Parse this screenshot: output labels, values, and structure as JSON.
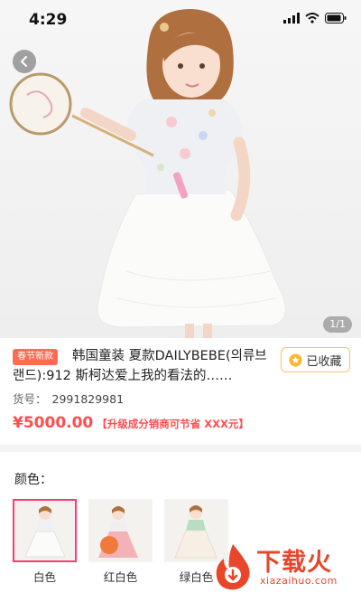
{
  "status_bar": {
    "time": "4:29"
  },
  "gallery": {
    "counter": "1/1"
  },
  "product": {
    "promo_tag": "春节新款",
    "title": "韩国童装 夏款DAILYBEBE(의류브랜드):912 斯柯达爱上我的看法的……",
    "favorite_label": "已收藏",
    "sku_label": "货号：",
    "sku_value": "2991829981",
    "price": "¥5000.00",
    "price_note": "【升级成分销商可节省 XXX元】"
  },
  "color_selector": {
    "heading": "颜色：",
    "options": [
      {
        "label": "白色",
        "selected": true,
        "dress_color": "#f5f3f0"
      },
      {
        "label": "红白色",
        "selected": false,
        "dress_color": "#f3b2b6"
      },
      {
        "label": "绿白色",
        "selected": false,
        "dress_color": "#b9dcc4"
      }
    ]
  },
  "watermark": {
    "text": "下载火",
    "subtext": "xiazaihuo.com"
  },
  "colors": {
    "accent": "#ff4d4f",
    "selected_border": "#ff3c6f",
    "favorite_border": "#f4c26b",
    "watermark": "#e8462b"
  }
}
